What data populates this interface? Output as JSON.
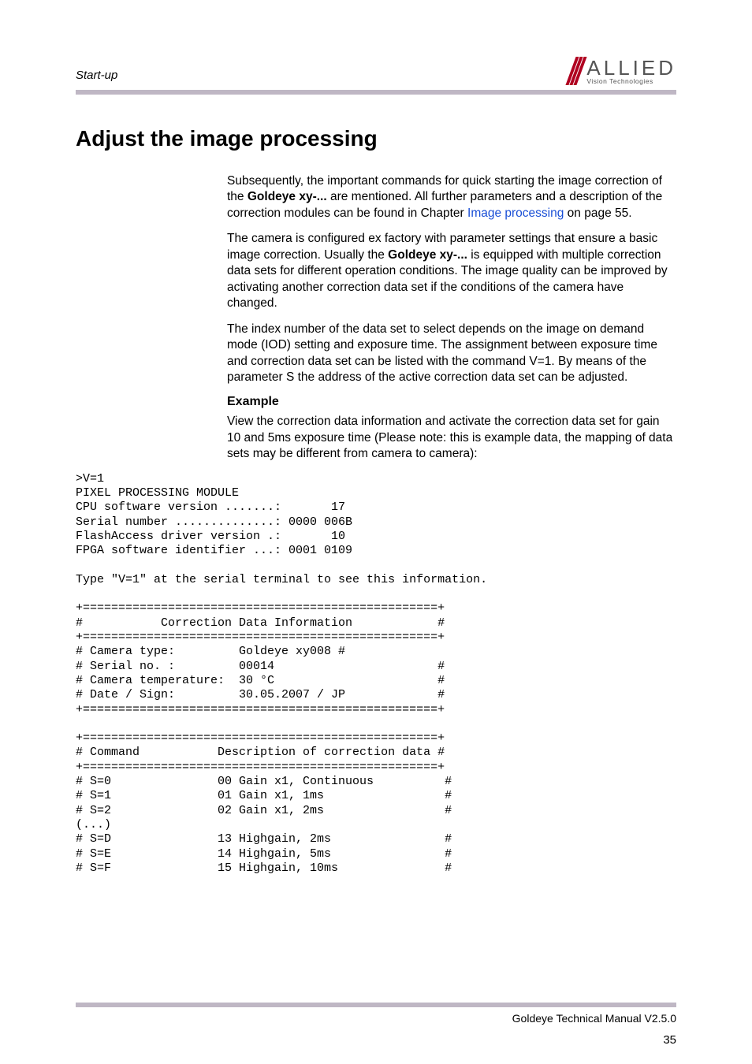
{
  "header": {
    "section_label": "Start-up",
    "logo_big": "ALLIED",
    "logo_small": "Vision Technologies"
  },
  "title": "Adjust the image processing",
  "para1_a": "Subsequently, the important commands for quick starting the image correction of the ",
  "para1_bold": "Goldeye xy-...",
  "para1_b": " are mentioned. All further parameters and a description of the correction modules can be found in Chapter ",
  "para1_link": "Image processing",
  "para1_c": " on page 55.",
  "para2_a": "The camera is configured ex factory with parameter settings that ensure a basic image correction. Usually the ",
  "para2_bold": "Goldeye xy-...",
  "para2_b": " is equipped with multiple correction data sets for different operation conditions. The image quality can be improved by activating another correction data set if the conditions of the camera have changed.",
  "para3": "The index number of the data set to select depends on the image on demand mode (IOD) setting and exposure time. The assignment between exposure time and correction data set can be listed with the command V=1. By means of the parameter S the address of the active correction data set can be adjusted.",
  "example_heading": "Example",
  "para4": "View the correction data information and activate the correction data set for gain 10 and 5ms exposure time (Please note: this is example data, the mapping of data sets may be different from camera to camera):",
  "code": ">V=1\nPIXEL PROCESSING MODULE\nCPU software version .......:       17\nSerial number ..............: 0000 006B\nFlashAccess driver version .:       10\nFPGA software identifier ...: 0001 0109\n\nType \"V=1\" at the serial terminal to see this information.\n\n+==================================================+\n#           Correction Data Information            #\n+==================================================+\n# Camera type:         Goldeye xy008 #\n# Serial no. :         00014                       #\n# Camera temperature:  30 °C                       #\n# Date / Sign:         30.05.2007 / JP             #\n+==================================================+\n\n+==================================================+\n# Command           Description of correction data #\n+==================================================+\n# S=0               00 Gain x1, Continuous          #\n# S=1               01 Gain x1, 1ms                 #\n# S=2               02 Gain x1, 2ms                 #\n(...)\n# S=D               13 Highgain, 2ms                #\n# S=E               14 Highgain, 5ms                #\n# S=F               15 Highgain, 10ms               #",
  "footer": {
    "manual": "Goldeye Technical Manual V2.5.0",
    "page": "35"
  }
}
